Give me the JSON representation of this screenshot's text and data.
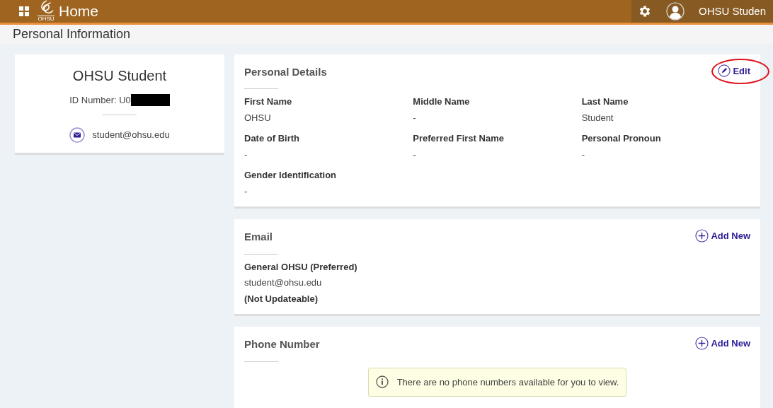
{
  "header": {
    "title": "Home",
    "logo_text": "OHSU",
    "user_name": "OHSU Studen"
  },
  "page_title": "Personal Information",
  "profile": {
    "name": "OHSU Student",
    "id_label": "ID Number: U0",
    "id_redacted": true,
    "email": "student@ohsu.edu"
  },
  "personal_details": {
    "title": "Personal Details",
    "action": {
      "label": "Edit",
      "highlighted": true
    },
    "fields": [
      {
        "label": "First Name",
        "value": "OHSU"
      },
      {
        "label": "Middle Name",
        "value": "-"
      },
      {
        "label": "Last Name",
        "value": "Student"
      },
      {
        "label": "Date of Birth",
        "value": "-"
      },
      {
        "label": "Preferred First Name",
        "value": "-"
      },
      {
        "label": "Personal Pronoun",
        "value": "-"
      },
      {
        "label": "Gender Identification",
        "value": "-"
      }
    ]
  },
  "email": {
    "title": "Email",
    "action": {
      "label": "Add New"
    },
    "type_label": "General OHSU (Preferred)",
    "address": "student@ohsu.edu",
    "note": "(Not Updateable)"
  },
  "phone": {
    "title": "Phone Number",
    "action": {
      "label": "Add New"
    },
    "message": "There are no phone numbers available for you to view."
  }
}
